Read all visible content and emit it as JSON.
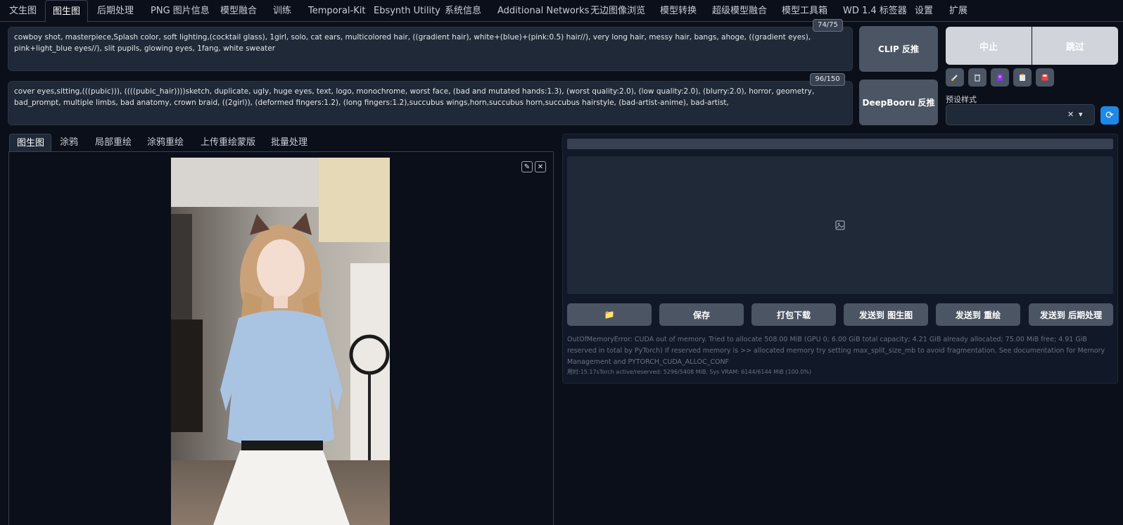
{
  "top_tabs": [
    {
      "label": "文生图"
    },
    {
      "label": "图生图"
    },
    {
      "label": "后期处理"
    },
    {
      "label": "PNG 图片信息"
    },
    {
      "label": "模型融合"
    },
    {
      "label": "训练"
    },
    {
      "label": "Temporal-Kit"
    },
    {
      "label": "Ebsynth Utility"
    },
    {
      "label": "系统信息"
    },
    {
      "label": "Additional Networks"
    },
    {
      "label": "无边图像浏览"
    },
    {
      "label": "模型转换"
    },
    {
      "label": "超级模型融合"
    },
    {
      "label": "模型工具箱"
    },
    {
      "label": "WD 1.4 标签器"
    },
    {
      "label": "设置"
    },
    {
      "label": "扩展"
    }
  ],
  "positive_prompt": {
    "text": "cowboy shot, masterpiece,Splash color, soft lighting,(cocktail glass), 1girl, solo, cat ears, multicolored hair, ((gradient hair), white+(blue)+(pink:0.5) hair//), very long hair, messy hair, bangs, ahoge, ((gradient eyes), pink+light_blue eyes//), slit pupils, glowing eyes, 1fang, white sweater",
    "counter": "74/75"
  },
  "negative_prompt": {
    "text": "cover eyes,sitting,(((pubic))), ((((pubic_hair))))sketch, duplicate, ugly, huge eyes, text, logo, monochrome, worst face, (bad and mutated hands:1.3), (worst quality:2.0), (low quality:2.0), (blurry:2.0), horror, geometry, bad_prompt, multiple limbs, bad anatomy, crown braid, ((2girl)), (deformed fingers:1.2), (long fingers:1.2),succubus wings,horn,succubus horn,succubus hairstyle, (bad-artist-anime), bad-artist,",
    "counter": "96/150"
  },
  "interrogate": {
    "clip_label": "CLIP 反推",
    "deepbooru_label": "DeepBooru 反推"
  },
  "controls": {
    "interrupt_label": "中止",
    "skip_label": "跳过"
  },
  "tool_icons": [
    "paint-brush-icon",
    "trash-icon",
    "style-card-icon",
    "clipboard-icon",
    "save-disk-icon"
  ],
  "preset": {
    "label": "预设样式",
    "clear_symbol": "✕",
    "arrow_symbol": "▾",
    "refresh_symbol": "⟳"
  },
  "img2img_tabs": [
    {
      "label": "图生图"
    },
    {
      "label": "涂鸦"
    },
    {
      "label": "局部重绘"
    },
    {
      "label": "涂鸦重绘"
    },
    {
      "label": "上传重绘蒙版"
    },
    {
      "label": "批量处理"
    }
  ],
  "image_controls": {
    "edit_symbol": "✎",
    "close_symbol": "✕"
  },
  "output_actions": {
    "folder_symbol": "📁",
    "save_label": "保存",
    "zip_label": "打包下载",
    "send_img2img_label": "发送到 图生图",
    "send_inpaint_label": "发送到 重绘",
    "send_extras_label": "发送到 后期处理"
  },
  "error_message": "OutOfMemoryError: CUDA out of memory. Tried to allocate 508.00 MiB (GPU 0; 6.00 GiB total capacity; 4.21 GiB already allocated; 75.00 MiB free; 4.91 GiB reserved in total by PyTorch) If reserved memory is >> allocated memory try setting max_split_size_mb to avoid fragmentation. See documentation for Memory Management and PYTORCH_CUDA_ALLOC_CONF",
  "time_info": "用时:15.17sTorch active/reserved: 5296/5408 MiB, Sys VRAM: 6144/6144 MiB (100.0%)",
  "colors": {
    "background": "#0b0f19",
    "panel": "#1f2937",
    "button": "#4b5563",
    "accent": "#1e88e5",
    "control_button": "#d1d5db"
  }
}
